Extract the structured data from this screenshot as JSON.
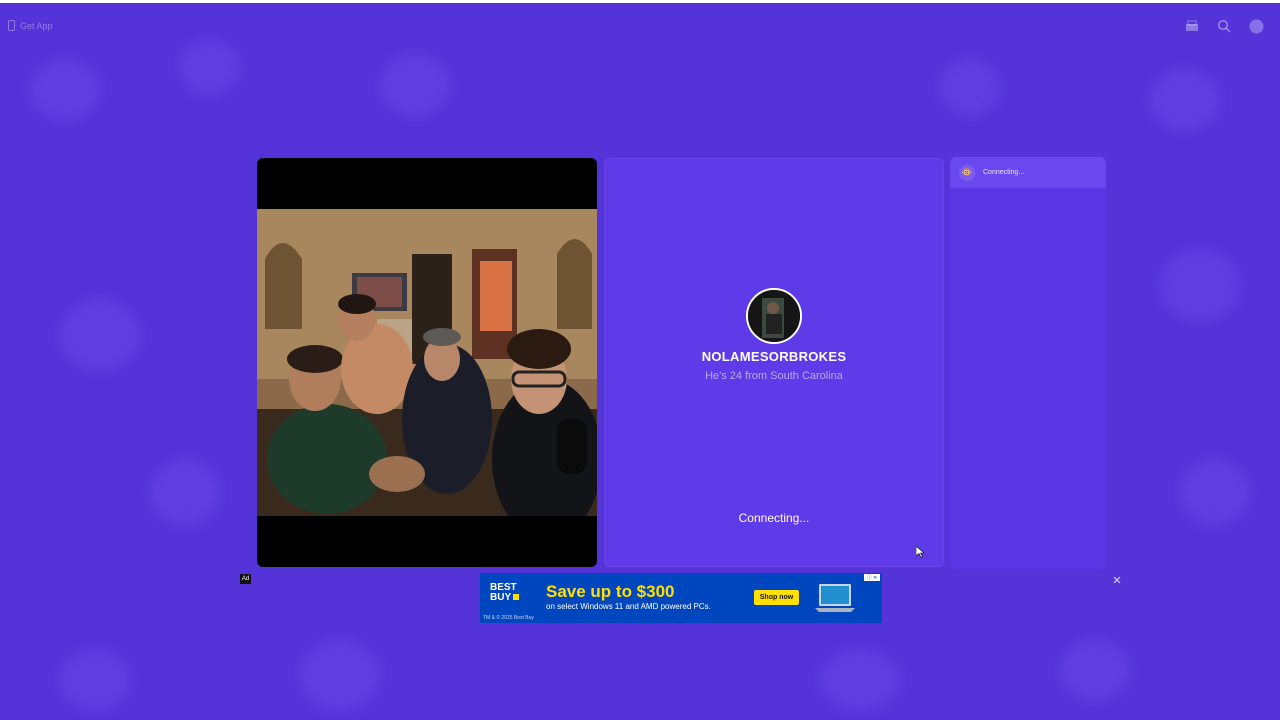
{
  "header": {
    "get_app_label": "Get App",
    "icons": [
      "shop-icon",
      "search-icon",
      "profile-icon"
    ]
  },
  "stranger": {
    "username": "NOLAMESORBROKES",
    "bio": "He's 24 from South Carolina",
    "connecting_label": "Connecting..."
  },
  "chat": {
    "status": "Connecting...",
    "avatar_icon": "monkey-face-icon"
  },
  "ad": {
    "tag": "Ad",
    "brand": "BEST BUY",
    "headline": "Save up to $300",
    "subtext": "on select Windows 11 and AMD powered PCs.",
    "cta": "Shop now",
    "legal": "TM & © 2025 Best Buy",
    "choices": "ⓘ ✕",
    "close": "✕"
  },
  "colors": {
    "background": "#5434d8",
    "panel": "#5e3ae8",
    "ad_blue": "#0046be",
    "ad_yellow": "#ffe000"
  }
}
